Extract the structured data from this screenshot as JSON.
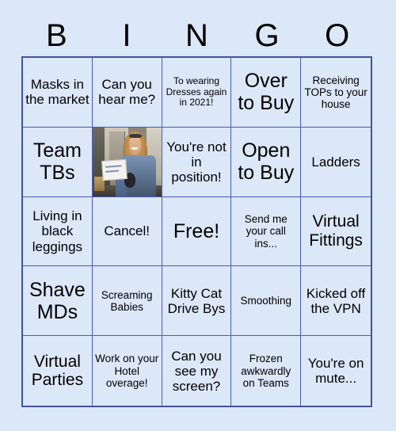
{
  "header": {
    "letters": [
      "B",
      "I",
      "N",
      "G",
      "O"
    ]
  },
  "colors": {
    "page_background": "#dce7f8",
    "grid_border": "#41539e",
    "cell_border": "#4a5bb0",
    "text": "#000000"
  },
  "grid": {
    "rows": 5,
    "columns": 5,
    "cells": [
      {
        "text": "Masks in the market",
        "size": "fs-md",
        "type": "text"
      },
      {
        "text": "Can you hear me?",
        "size": "fs-md",
        "type": "text"
      },
      {
        "text": "To wearing Dresses again in 2021!",
        "size": "fs-xs",
        "type": "text"
      },
      {
        "text": "Over to Buy",
        "size": "fs-xl",
        "type": "text"
      },
      {
        "text": "Receiving TOPs to your house",
        "size": "fs-sm",
        "type": "text"
      },
      {
        "text": "Team TBs",
        "size": "fs-xl",
        "type": "text"
      },
      {
        "text": "",
        "size": "fs-md",
        "type": "photo",
        "alt": "Woman with blonde hair and sunglasses on her head, wearing a denim jacket, smiling and holding a handwritten white sign indoors"
      },
      {
        "text": "You're not in position!",
        "size": "fs-md",
        "type": "text"
      },
      {
        "text": "Open to Buy",
        "size": "fs-xl",
        "type": "text"
      },
      {
        "text": "Ladders",
        "size": "fs-md",
        "type": "text"
      },
      {
        "text": "Living in black leggings",
        "size": "fs-md",
        "type": "text"
      },
      {
        "text": "Cancel!",
        "size": "fs-md",
        "type": "text"
      },
      {
        "text": "Free!",
        "size": "fs-xl",
        "type": "text"
      },
      {
        "text": "Send me your call ins...",
        "size": "fs-sm",
        "type": "text"
      },
      {
        "text": "Virtual Fittings",
        "size": "fs-lg",
        "type": "text"
      },
      {
        "text": "Shave MDs",
        "size": "fs-xl",
        "type": "text"
      },
      {
        "text": "Screaming Babies",
        "size": "fs-sm",
        "type": "text"
      },
      {
        "text": "Kitty Cat Drive Bys",
        "size": "fs-md",
        "type": "text"
      },
      {
        "text": "Smoothing",
        "size": "fs-sm",
        "type": "text"
      },
      {
        "text": "Kicked off the VPN",
        "size": "fs-md",
        "type": "text"
      },
      {
        "text": "Virtual Parties",
        "size": "fs-lg",
        "type": "text"
      },
      {
        "text": "Work on your Hotel overage!",
        "size": "fs-sm",
        "type": "text"
      },
      {
        "text": "Can you see my screen?",
        "size": "fs-md",
        "type": "text"
      },
      {
        "text": "Frozen awkwardly on Teams",
        "size": "fs-sm",
        "type": "text"
      },
      {
        "text": "You're on mute...",
        "size": "fs-md",
        "type": "text"
      }
    ]
  }
}
